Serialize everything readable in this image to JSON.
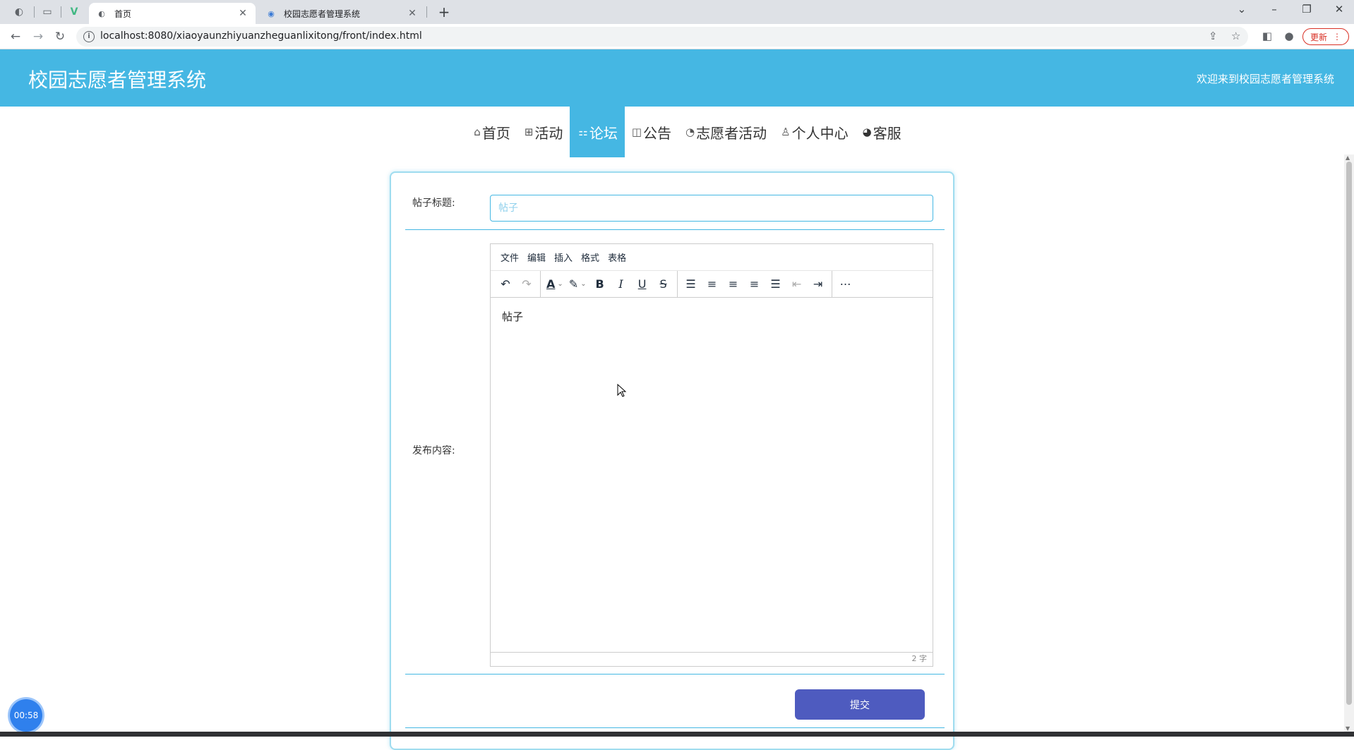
{
  "browser": {
    "tabs": [
      {
        "title": "首页",
        "active": true
      },
      {
        "title": "校园志愿者管理系统",
        "active": false
      }
    ],
    "url": "localhost:8080/xiaoyaunzhiyuanzheguanlixitong/front/index.html",
    "update_label": "更新"
  },
  "header": {
    "title": "校园志愿者管理系统",
    "welcome": "欢迎来到校园志愿者管理系统",
    "bg_color": "#45b7e3"
  },
  "nav": {
    "items": [
      {
        "label": "首页",
        "icon": "home-icon",
        "active": false
      },
      {
        "label": "活动",
        "icon": "grid-icon",
        "active": false
      },
      {
        "label": "论坛",
        "icon": "forum-icon",
        "active": true
      },
      {
        "label": "公告",
        "icon": "notice-icon",
        "active": false
      },
      {
        "label": "志愿者活动",
        "icon": "palette-icon",
        "active": false
      },
      {
        "label": "个人中心",
        "icon": "user-icon",
        "active": false
      },
      {
        "label": "客服",
        "icon": "service-icon",
        "active": false
      }
    ]
  },
  "form": {
    "title_label": "帖子标题:",
    "title_placeholder": "帖子",
    "title_value": "",
    "content_label": "发布内容:",
    "editor": {
      "menus": [
        "文件",
        "编辑",
        "插入",
        "格式",
        "表格"
      ],
      "content": "帖子",
      "word_count": "2 字"
    },
    "submit_label": "提交",
    "submit_color": "#4e5bbf"
  },
  "timer": "00:58"
}
